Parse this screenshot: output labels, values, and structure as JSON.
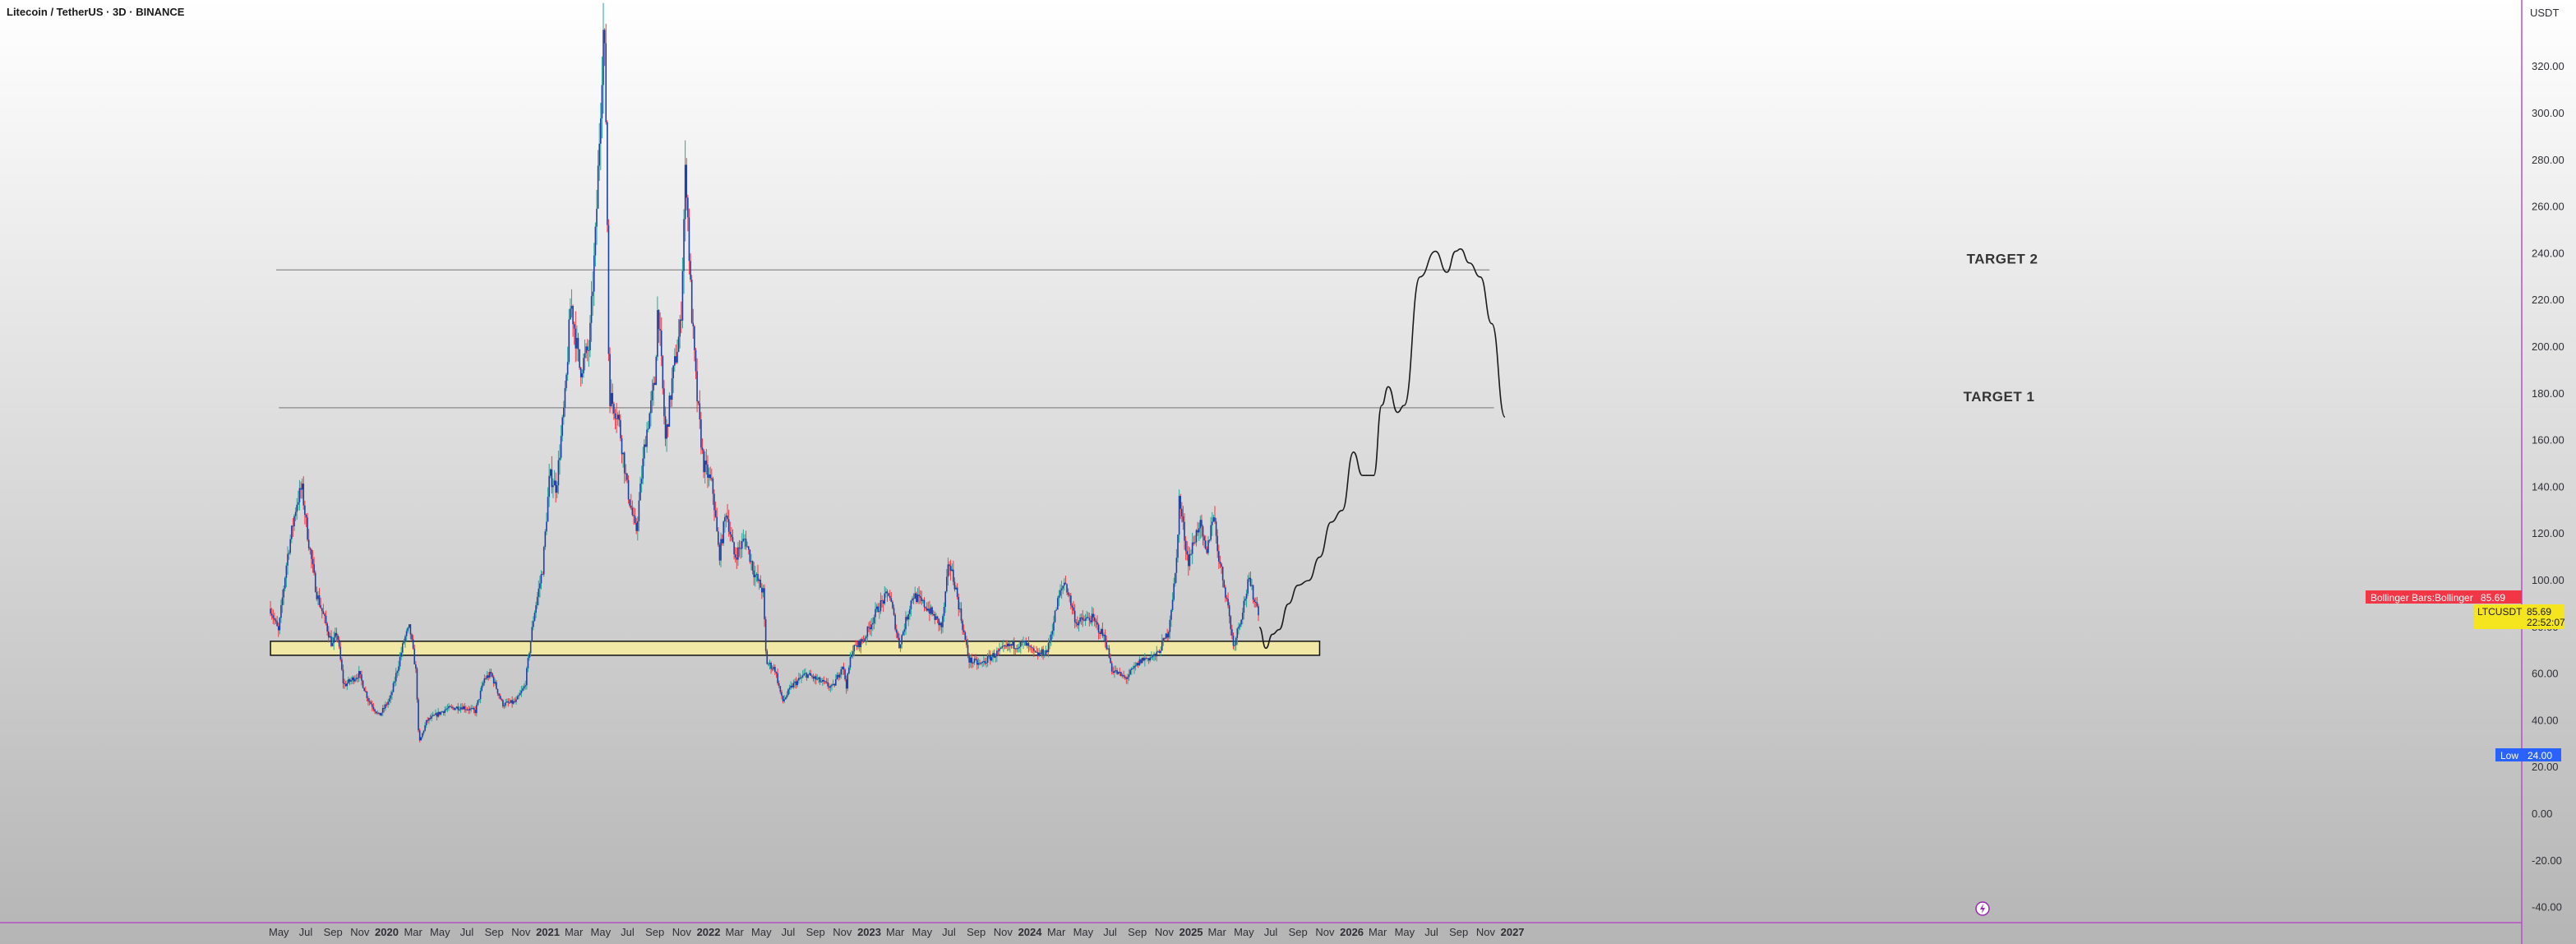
{
  "chart_data": {
    "type": "candlestick",
    "title": "Litecoin / TetherUS · 3D · BINANCE",
    "y_unit": "USDT",
    "ylim": [
      -44,
      352
    ],
    "y_ticks": [
      -40,
      -20,
      0,
      20,
      40,
      60,
      80,
      100,
      120,
      140,
      160,
      180,
      200,
      220,
      240,
      260,
      280,
      300,
      320
    ],
    "y_tick_labels": [
      "-40.00",
      "-20.00",
      "0.00",
      "20.00",
      "40.00",
      "60.00",
      "80.00",
      "100.00",
      "120.00",
      "140.00",
      "160.00",
      "180.00",
      "200.00",
      "220.00",
      "240.00",
      "260.00",
      "280.00",
      "300.00",
      "320.00"
    ],
    "x_ticks": [
      {
        "label": "May",
        "date": "2019-05-01",
        "year": false
      },
      {
        "label": "Jul",
        "date": "2019-07-01",
        "year": false
      },
      {
        "label": "Sep",
        "date": "2019-09-01",
        "year": false
      },
      {
        "label": "Nov",
        "date": "2019-11-01",
        "year": false
      },
      {
        "label": "2020",
        "date": "2020-01-01",
        "year": true
      },
      {
        "label": "Mar",
        "date": "2020-03-01",
        "year": false
      },
      {
        "label": "May",
        "date": "2020-05-01",
        "year": false
      },
      {
        "label": "Jul",
        "date": "2020-07-01",
        "year": false
      },
      {
        "label": "Sep",
        "date": "2020-09-01",
        "year": false
      },
      {
        "label": "Nov",
        "date": "2020-11-01",
        "year": false
      },
      {
        "label": "2021",
        "date": "2021-01-01",
        "year": true
      },
      {
        "label": "Mar",
        "date": "2021-03-01",
        "year": false
      },
      {
        "label": "May",
        "date": "2021-05-01",
        "year": false
      },
      {
        "label": "Jul",
        "date": "2021-07-01",
        "year": false
      },
      {
        "label": "Sep",
        "date": "2021-09-01",
        "year": false
      },
      {
        "label": "Nov",
        "date": "2021-11-01",
        "year": false
      },
      {
        "label": "2022",
        "date": "2022-01-01",
        "year": true
      },
      {
        "label": "Mar",
        "date": "2022-03-01",
        "year": false
      },
      {
        "label": "May",
        "date": "2022-05-01",
        "year": false
      },
      {
        "label": "Jul",
        "date": "2022-07-01",
        "year": false
      },
      {
        "label": "Sep",
        "date": "2022-09-01",
        "year": false
      },
      {
        "label": "Nov",
        "date": "2022-11-01",
        "year": false
      },
      {
        "label": "2023",
        "date": "2023-01-01",
        "year": true
      },
      {
        "label": "Mar",
        "date": "2023-03-01",
        "year": false
      },
      {
        "label": "May",
        "date": "2023-05-01",
        "year": false
      },
      {
        "label": "Jul",
        "date": "2023-07-01",
        "year": false
      },
      {
        "label": "Sep",
        "date": "2023-09-01",
        "year": false
      },
      {
        "label": "Nov",
        "date": "2023-11-01",
        "year": false
      },
      {
        "label": "2024",
        "date": "2024-01-01",
        "year": true
      },
      {
        "label": "Mar",
        "date": "2024-03-01",
        "year": false
      },
      {
        "label": "May",
        "date": "2024-05-01",
        "year": false
      },
      {
        "label": "Jul",
        "date": "2024-07-01",
        "year": false
      },
      {
        "label": "Sep",
        "date": "2024-09-01",
        "year": false
      },
      {
        "label": "Nov",
        "date": "2024-11-01",
        "year": false
      },
      {
        "label": "2025",
        "date": "2025-01-01",
        "year": true
      },
      {
        "label": "Mar",
        "date": "2025-03-01",
        "year": false
      },
      {
        "label": "May",
        "date": "2025-05-01",
        "year": false
      },
      {
        "label": "Jul",
        "date": "2025-07-01",
        "year": false
      },
      {
        "label": "Sep",
        "date": "2025-09-01",
        "year": false
      },
      {
        "label": "Nov",
        "date": "2025-11-01",
        "year": false
      },
      {
        "label": "2026",
        "date": "2026-01-01",
        "year": true
      },
      {
        "label": "Mar",
        "date": "2026-03-01",
        "year": false
      },
      {
        "label": "May",
        "date": "2026-05-01",
        "year": false
      },
      {
        "label": "Jul",
        "date": "2026-07-01",
        "year": false
      },
      {
        "label": "Sep",
        "date": "2026-09-01",
        "year": false
      },
      {
        "label": "Nov",
        "date": "2026-11-01",
        "year": false
      },
      {
        "label": "2027",
        "date": "2027-01-01",
        "year": true
      }
    ],
    "price_path": [
      [
        "2019-04-12",
        88
      ],
      [
        "2019-04-30",
        78
      ],
      [
        "2019-05-20",
        110
      ],
      [
        "2019-06-10",
        133
      ],
      [
        "2019-06-22",
        140
      ],
      [
        "2019-07-05",
        120
      ],
      [
        "2019-07-25",
        95
      ],
      [
        "2019-08-15",
        82
      ],
      [
        "2019-08-30",
        72
      ],
      [
        "2019-09-10",
        78
      ],
      [
        "2019-09-25",
        55
      ],
      [
        "2019-10-10",
        57
      ],
      [
        "2019-10-30",
        60
      ],
      [
        "2019-11-20",
        49
      ],
      [
        "2019-12-15",
        42
      ],
      [
        "2020-01-10",
        50
      ],
      [
        "2020-02-10",
        75
      ],
      [
        "2020-02-22",
        80
      ],
      [
        "2020-03-08",
        60
      ],
      [
        "2020-03-14",
        30
      ],
      [
        "2020-04-01",
        40
      ],
      [
        "2020-05-15",
        45
      ],
      [
        "2020-06-20",
        46
      ],
      [
        "2020-07-20",
        44
      ],
      [
        "2020-08-10",
        58
      ],
      [
        "2020-08-25",
        60
      ],
      [
        "2020-09-20",
        47
      ],
      [
        "2020-10-20",
        48
      ],
      [
        "2020-11-10",
        55
      ],
      [
        "2020-11-30",
        85
      ],
      [
        "2020-12-20",
        105
      ],
      [
        "2021-01-05",
        145
      ],
      [
        "2021-01-20",
        140
      ],
      [
        "2021-02-10",
        180
      ],
      [
        "2021-02-22",
        220
      ],
      [
        "2021-03-15",
        190
      ],
      [
        "2021-04-05",
        200
      ],
      [
        "2021-04-20",
        250
      ],
      [
        "2021-05-08",
        340
      ],
      [
        "2021-05-14",
        290
      ],
      [
        "2021-05-20",
        180
      ],
      [
        "2021-06-10",
        170
      ],
      [
        "2021-06-30",
        140
      ],
      [
        "2021-07-20",
        120
      ],
      [
        "2021-08-10",
        160
      ],
      [
        "2021-09-01",
        185
      ],
      [
        "2021-09-08",
        220
      ],
      [
        "2021-09-25",
        160
      ],
      [
        "2021-10-10",
        185
      ],
      [
        "2021-10-30",
        210
      ],
      [
        "2021-11-10",
        280
      ],
      [
        "2021-11-22",
        220
      ],
      [
        "2021-12-05",
        180
      ],
      [
        "2021-12-20",
        150
      ],
      [
        "2022-01-10",
        140
      ],
      [
        "2022-01-25",
        110
      ],
      [
        "2022-02-10",
        130
      ],
      [
        "2022-03-01",
        110
      ],
      [
        "2022-03-25",
        118
      ],
      [
        "2022-04-15",
        103
      ],
      [
        "2022-05-05",
        95
      ],
      [
        "2022-05-12",
        65
      ],
      [
        "2022-06-01",
        62
      ],
      [
        "2022-06-18",
        48
      ],
      [
        "2022-07-10",
        55
      ],
      [
        "2022-08-10",
        60
      ],
      [
        "2022-09-10",
        57
      ],
      [
        "2022-10-10",
        54
      ],
      [
        "2022-11-01",
        64
      ],
      [
        "2022-11-10",
        55
      ],
      [
        "2022-11-22",
        70
      ],
      [
        "2022-12-20",
        75
      ],
      [
        "2023-01-20",
        88
      ],
      [
        "2023-02-15",
        95
      ],
      [
        "2023-03-10",
        72
      ],
      [
        "2023-04-10",
        94
      ],
      [
        "2023-05-15",
        88
      ],
      [
        "2023-06-15",
        80
      ],
      [
        "2023-07-01",
        108
      ],
      [
        "2023-07-15",
        98
      ],
      [
        "2023-08-15",
        66
      ],
      [
        "2023-09-10",
        64
      ],
      [
        "2023-10-10",
        68
      ],
      [
        "2023-11-15",
        72
      ],
      [
        "2023-12-20",
        73
      ],
      [
        "2024-01-15",
        68
      ],
      [
        "2024-02-10",
        70
      ],
      [
        "2024-03-05",
        92
      ],
      [
        "2024-03-20",
        100
      ],
      [
        "2024-04-15",
        82
      ],
      [
        "2024-05-20",
        84
      ],
      [
        "2024-06-20",
        75
      ],
      [
        "2024-07-05",
        62
      ],
      [
        "2024-08-05",
        58
      ],
      [
        "2024-09-10",
        66
      ],
      [
        "2024-10-15",
        68
      ],
      [
        "2024-11-10",
        78
      ],
      [
        "2024-11-28",
        105
      ],
      [
        "2024-12-05",
        135
      ],
      [
        "2024-12-25",
        108
      ],
      [
        "2025-01-20",
        125
      ],
      [
        "2025-02-05",
        110
      ],
      [
        "2025-02-20",
        130
      ],
      [
        "2025-03-05",
        110
      ],
      [
        "2025-03-25",
        90
      ],
      [
        "2025-04-07",
        72
      ],
      [
        "2025-04-25",
        85
      ],
      [
        "2025-05-12",
        100
      ],
      [
        "2025-05-25",
        92
      ],
      [
        "2025-06-05",
        86
      ]
    ],
    "last_price": 85.69,
    "all_time_low_label": "Low",
    "all_time_low_value": "24.00",
    "symbol_label": "LTCUSDT",
    "symbol_price": "85.69",
    "countdown": "22:52:07",
    "indicator_label": "Bollinger Bars:Bollinger Bars Body",
    "indicator_value": "85.69",
    "support_zone": {
      "low": 68,
      "high": 74,
      "from": "2019-04-12",
      "to": "2025-10-20",
      "color": "#f1e8a6"
    },
    "targets": [
      {
        "label": "TARGET 1",
        "price": 174,
        "from": "2019-05-01",
        "to": "2026-11-20"
      },
      {
        "label": "TARGET 2",
        "price": 233,
        "from": "2019-04-25",
        "to": "2026-11-10"
      }
    ],
    "projection_path": [
      [
        "2025-06-05",
        80
      ],
      [
        "2025-06-20",
        71
      ],
      [
        "2025-07-05",
        77
      ],
      [
        "2025-07-20",
        79
      ],
      [
        "2025-08-10",
        90
      ],
      [
        "2025-09-01",
        98
      ],
      [
        "2025-09-25",
        100
      ],
      [
        "2025-10-20",
        110
      ],
      [
        "2025-11-15",
        125
      ],
      [
        "2025-12-10",
        130
      ],
      [
        "2026-01-05",
        155
      ],
      [
        "2026-01-25",
        145
      ],
      [
        "2026-02-20",
        145
      ],
      [
        "2026-03-10",
        175
      ],
      [
        "2026-03-25",
        183
      ],
      [
        "2026-04-15",
        172
      ],
      [
        "2026-04-30",
        175
      ],
      [
        "2026-06-05",
        230
      ],
      [
        "2026-07-10",
        241
      ],
      [
        "2026-08-05",
        232
      ],
      [
        "2026-08-25",
        241
      ],
      [
        "2026-09-05",
        242
      ],
      [
        "2026-09-25",
        236
      ],
      [
        "2026-10-20",
        230
      ],
      [
        "2026-11-15",
        210
      ],
      [
        "2026-12-15",
        170
      ]
    ],
    "colors": {
      "up": "#26a69a",
      "down": "#f23645",
      "body": "#1f3fa3",
      "zone": "#f1e8a6",
      "target_line": "#8a8a8a",
      "projection": "#1b1b1b"
    }
  }
}
